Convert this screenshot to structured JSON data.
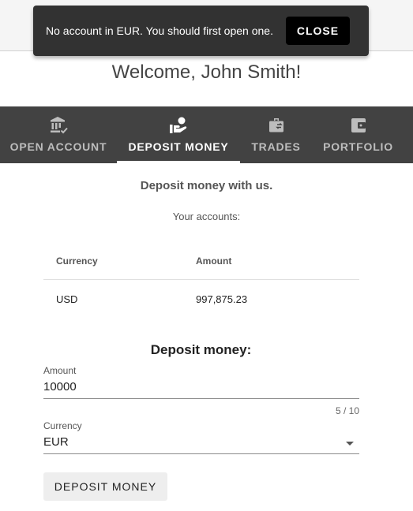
{
  "snackbar": {
    "message": "No account in EUR. You should first open one.",
    "close_label": "CLOSE"
  },
  "welcome": "Welcome, John Smith!",
  "tabs": [
    {
      "label": "OPEN ACCOUNT",
      "icon": "bank-check-icon"
    },
    {
      "label": "DEPOSIT MONEY",
      "icon": "hand-deposit-icon",
      "active": true
    },
    {
      "label": "TRADES",
      "icon": "briefcase-exchange-icon"
    },
    {
      "label": "PORTFOLIO",
      "icon": "wallet-icon"
    }
  ],
  "main": {
    "section_title": "Deposit money with us.",
    "accounts_label": "Your accounts:",
    "table": {
      "headers": [
        "Currency",
        "Amount"
      ],
      "rows": [
        [
          "USD",
          "997,875.23"
        ]
      ]
    },
    "form": {
      "title": "Deposit money:",
      "amount_label": "Amount",
      "amount_value": "10000",
      "amount_counter": "5 / 10",
      "currency_label": "Currency",
      "currency_value": "EUR",
      "submit_label": "DEPOSIT MONEY"
    }
  },
  "colors": {
    "tabbar_bg": "#424242",
    "snackbar_bg": "#323232",
    "close_button_bg": "#000000"
  }
}
